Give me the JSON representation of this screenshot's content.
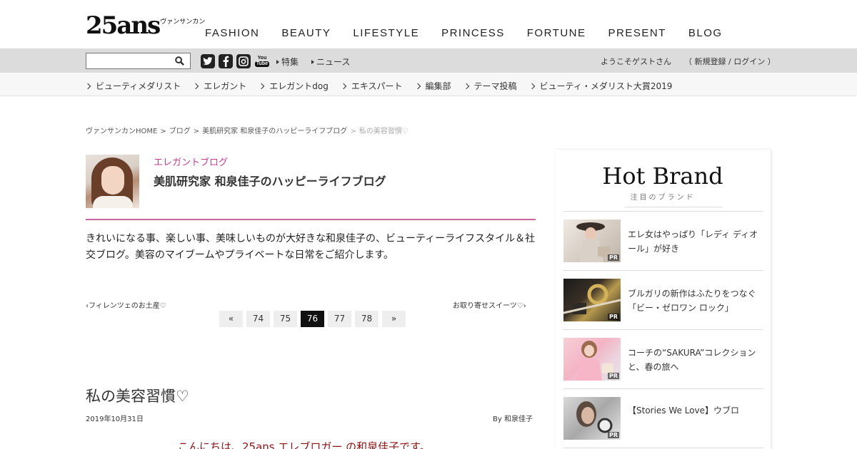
{
  "header": {
    "logo_main": "25ans",
    "logo_kana": "ヴァンサンカン",
    "nav": [
      "FASHION",
      "BEAUTY",
      "LIFESTYLE",
      "PRINCESS",
      "FORTUNE",
      "PRESENT",
      "BLOG"
    ]
  },
  "topbar": {
    "search_value": "",
    "social": [
      "twitter-icon",
      "facebook-icon",
      "instagram-icon",
      "youtube-icon"
    ],
    "youtube_top": "You",
    "youtube_bottom": "Tube",
    "links": [
      "特集",
      "ニュース"
    ],
    "welcome": "ようこそゲストさん",
    "register": "（ 新規登録 / ログイン ）"
  },
  "categories": [
    "ビューティメダリスト",
    "エレガント",
    "エレガントdog",
    "エキスパート",
    "編集部",
    "テーマ投稿",
    "ビューティ・メダリスト大賞2019"
  ],
  "breadcrumb": {
    "items": [
      "ヴァンサンカンHOME",
      "ブログ",
      "美肌研究家 和泉佳子のハッピーライフブログ"
    ],
    "current": "私の美容習慣♡",
    "separator": ">"
  },
  "blog": {
    "category": "エレガントブログ",
    "title": "美肌研究家 和泉佳子のハッピーライフブログ",
    "description": "きれいになる事、楽しい事、美味しいものが大好きな和泉佳子の、ビューティーライフスタイル＆社交ブログ。美容のマイブームやプライベートな日常をご紹介します。"
  },
  "navigation": {
    "prev": "フィレンツェのお土産♡",
    "next": "お取り寄せスイーツ♡",
    "prev_arrow": "‹",
    "next_arrow": "›",
    "pages": [
      "«",
      "74",
      "75",
      "76",
      "77",
      "78",
      "»"
    ],
    "active_page": "76"
  },
  "article": {
    "title": "私の美容習慣♡",
    "date": "2019年10月31日",
    "author": "By 和泉佳子",
    "body_start": "こんにちは、25ans エレブロガー の和泉佳子です。"
  },
  "sidebar": {
    "title": "Hot Brand",
    "subtitle": "注目のブランド",
    "pr_label": "PR",
    "items": [
      {
        "text": "エレ女はやっぱり「レディ ディオール」が好き"
      },
      {
        "text": "ブルガリの新作はふたりをつなぐ「ビー・ゼロワン ロック」"
      },
      {
        "text": "コーチの“SAKURA”コレクションと、春の旅へ"
      },
      {
        "text": "【Stories We Love】ウブロ"
      }
    ]
  },
  "colors": {
    "accent_pink": "#c83c8e",
    "pink_line": "#c765a2",
    "body_red": "#8b1010",
    "topbar_gray": "#dcdcdc"
  }
}
